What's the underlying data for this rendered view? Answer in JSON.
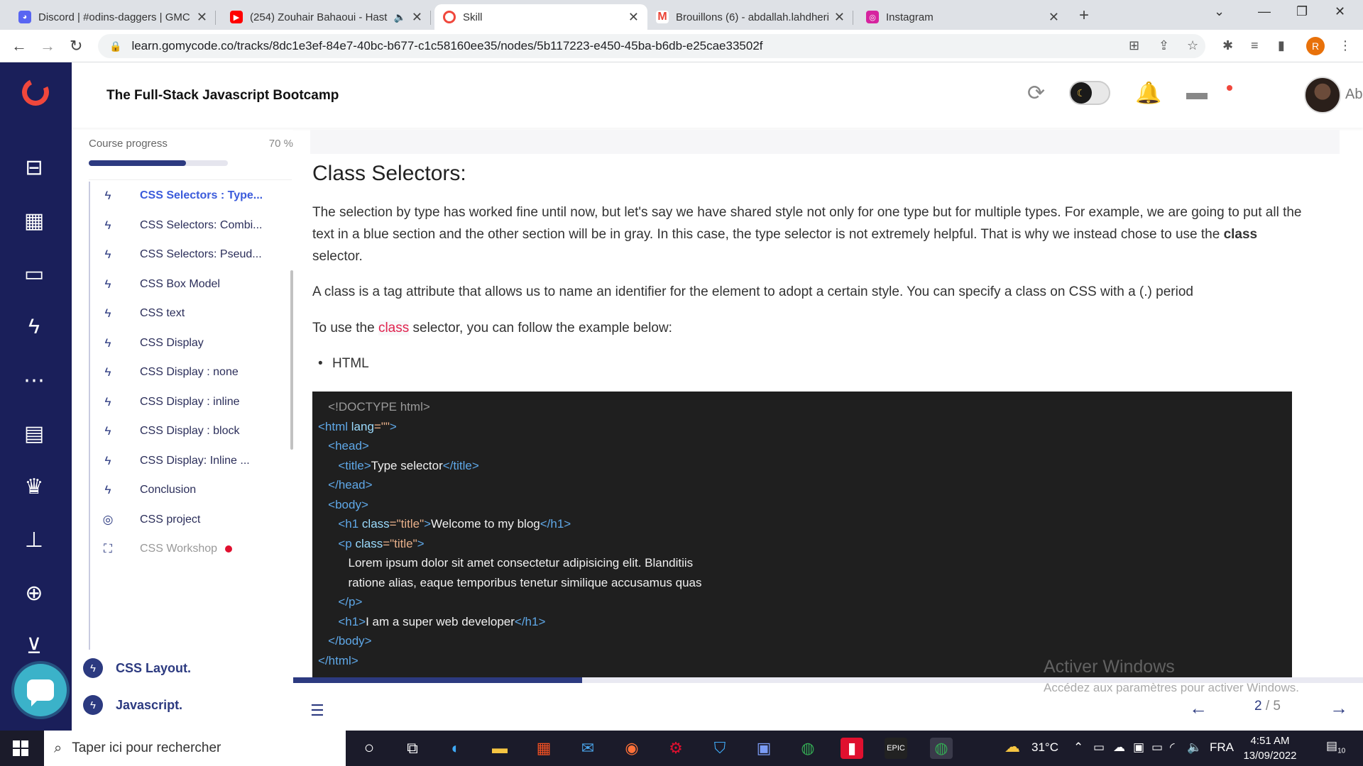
{
  "browser": {
    "tabs": [
      {
        "title": "Discord | #odins-daggers | GMC",
        "favicon_color": "#5865f2"
      },
      {
        "title": "(254) Zouhair Bahaoui - Hast",
        "favicon_color": "#ff0000"
      },
      {
        "title": "Skill",
        "favicon_color": "#f0473c"
      },
      {
        "title": "Brouillons (6) - abdallah.lahdheri",
        "favicon_color": "#ea4335"
      },
      {
        "title": "Instagram",
        "favicon_color": "#d6249f"
      }
    ],
    "url": "learn.gomycode.co/tracks/8dc1e3ef-84e7-40bc-b677-c1c58160ee35/nodes/5b117223-e450-45ba-b6db-e25cae33502f",
    "profile_initial": "R"
  },
  "header": {
    "course_title": "The Full-Stack Javascript Bootcamp",
    "username": "Abdallah"
  },
  "sidebar": {
    "progress_label": "Course progress",
    "progress_text": "70 %",
    "progress_value": 0.7,
    "lessons": [
      {
        "label": "CSS Selectors : Type...",
        "icon": "bolt-icon",
        "state": "active"
      },
      {
        "label": "CSS Selectors: Combi...",
        "icon": "bolt-icon",
        "state": "normal"
      },
      {
        "label": "CSS Selectors: Pseud...",
        "icon": "bolt-icon",
        "state": "normal"
      },
      {
        "label": "CSS Box Model",
        "icon": "bolt-icon",
        "state": "normal"
      },
      {
        "label": "CSS text",
        "icon": "bolt-icon",
        "state": "normal"
      },
      {
        "label": "CSS Display",
        "icon": "bolt-icon",
        "state": "normal"
      },
      {
        "label": "CSS Display : none",
        "icon": "bolt-icon",
        "state": "normal"
      },
      {
        "label": "CSS Display : inline",
        "icon": "bolt-icon",
        "state": "normal"
      },
      {
        "label": "CSS Display : block",
        "icon": "bolt-icon",
        "state": "normal"
      },
      {
        "label": "CSS Display: Inline ...",
        "icon": "bolt-icon",
        "state": "normal"
      },
      {
        "label": "Conclusion",
        "icon": "bolt-icon",
        "state": "normal"
      },
      {
        "label": "CSS project",
        "icon": "target-icon",
        "state": "normal"
      },
      {
        "label": "CSS Workshop",
        "icon": "workshop-icon",
        "state": "locked"
      }
    ],
    "modules": [
      {
        "label": "CSS Layout."
      },
      {
        "label": "Javascript."
      }
    ]
  },
  "content": {
    "heading": "Class Selectors:",
    "para1_before": "The selection by type has worked fine until now, but let's say we have shared style not only for one type but for multiple types. For example, we are going to put all the text in a blue section and the other section will be in gray. In this case, the type selector is not extremely helpful. That is why we instead chose to use the ",
    "para1_bold": "class",
    "para1_after": " selector.",
    "para2": "A class is a tag attribute that allows us to name an identifier for the element to adopt a certain style. You can specify a class on CSS with a (.) period",
    "para3_before": "To use the ",
    "para3_code": "class",
    "para3_after": " selector, you can follow the example below:",
    "bullet": "HTML",
    "code": {
      "doctype": "<!DOCTYPE html>",
      "html_open_tag": "<html",
      "lang_attr": "lang",
      "lang_val": "=\"\"",
      "gt": ">",
      "head_open": "<head>",
      "title_open": "<title>",
      "title_text": "Type selector",
      "title_close": "</title>",
      "head_close": "</head>",
      "body_open": "<body>",
      "h1_open": "<h1",
      "class_attr": "class",
      "class_val": "=\"title\"",
      "h1_text": "Welcome to my blog",
      "h1_close": "</h1>",
      "p_open": "<p",
      "lorem1": "Lorem ipsum dolor sit amet consectetur adipisicing elit. Blanditiis",
      "lorem2": "ratione alias, eaque temporibus tenetur similique accusamus quas",
      "p_close": "</p>",
      "h1b_open": "<h1>",
      "h1b_text": "I am a super web developer",
      "body_close": "</body>",
      "html_close": "</html>"
    }
  },
  "pager": {
    "current": "2",
    "total": "/ 5",
    "progress_value": 0.27
  },
  "watermark": {
    "line1": "Activer Windows",
    "line2": "Accédez aux paramètres pour activer Windows."
  },
  "taskbar": {
    "search_placeholder": "Taper ici pour rechercher",
    "weather": "31°C",
    "language": "FRA",
    "time": "4:51 AM",
    "date": "13/09/2022",
    "notifications": "10"
  }
}
